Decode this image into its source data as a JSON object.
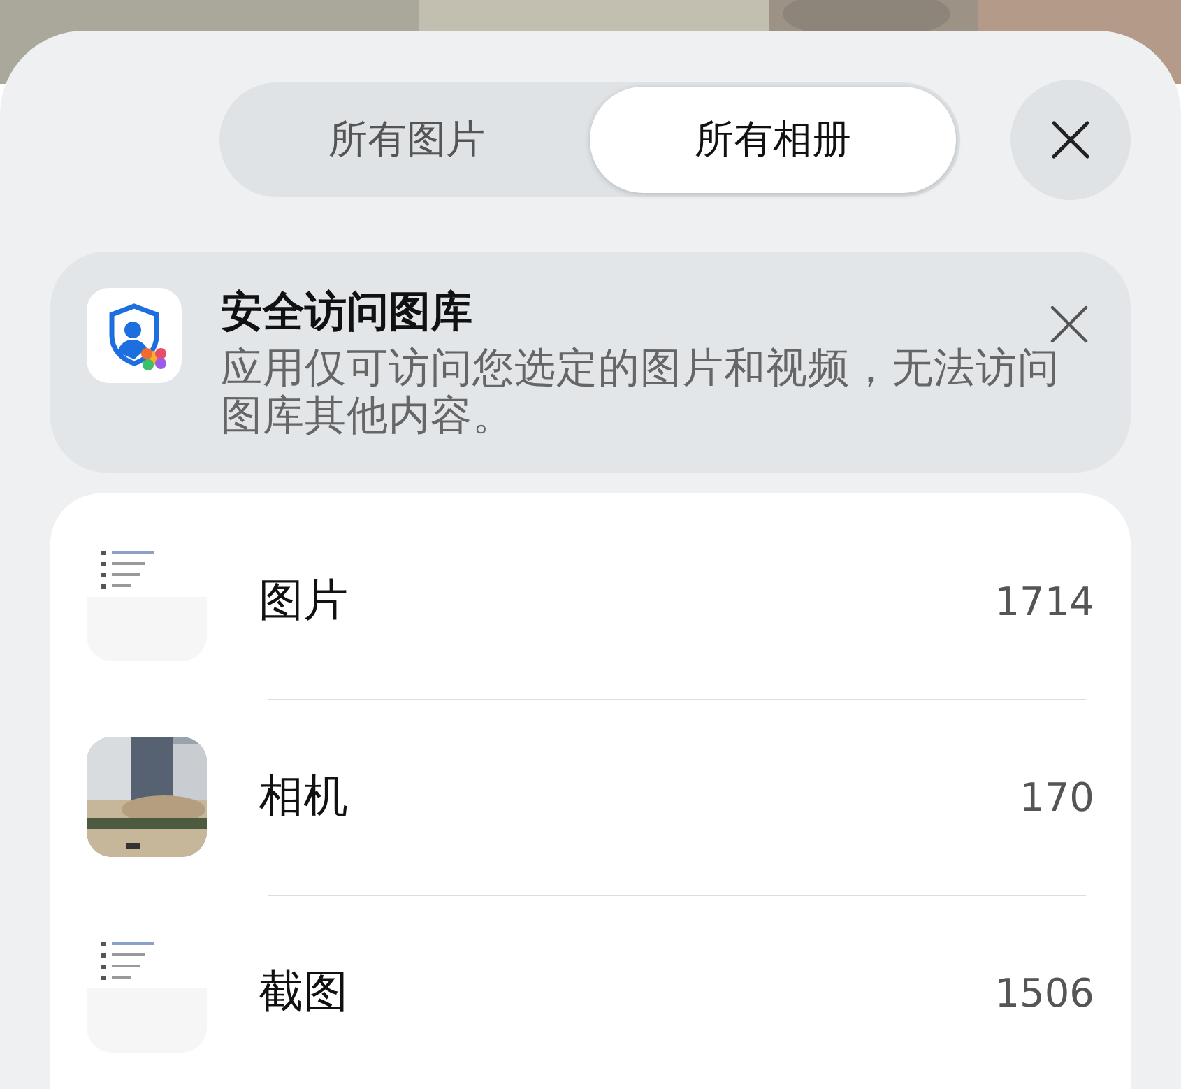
{
  "tabs": [
    {
      "label": "所有图片",
      "selected": false
    },
    {
      "label": "所有相册",
      "selected": true
    }
  ],
  "notice": {
    "title": "安全访问图库",
    "text": "应用仅可访问您选定的图片和视频，无法访问图库其他内容。"
  },
  "albums": [
    {
      "name": "图片",
      "count": "1714"
    },
    {
      "name": "相机",
      "count": "170"
    },
    {
      "name": "截图",
      "count": "1506"
    }
  ]
}
